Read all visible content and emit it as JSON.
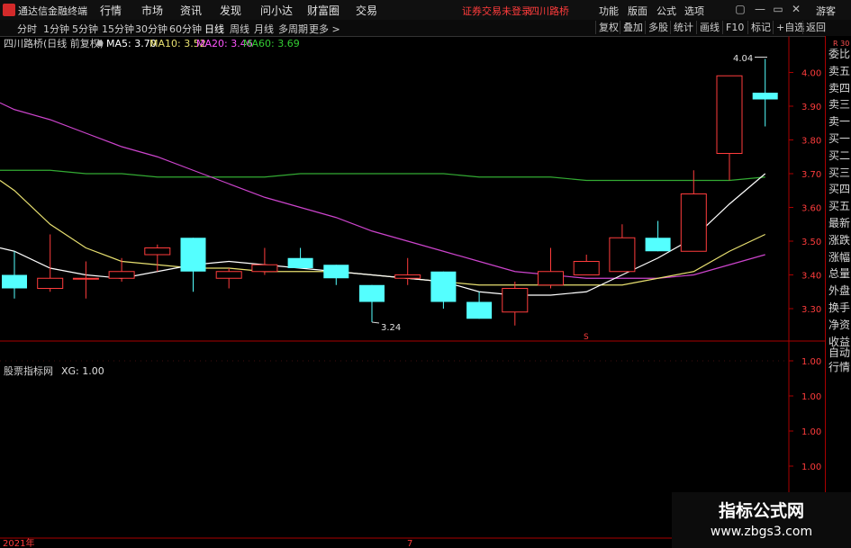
{
  "app": {
    "name": "通达信金融终端",
    "menu": [
      "行情",
      "市场",
      "资讯",
      "发现",
      "问小达",
      "财富圈",
      "交易"
    ],
    "status_text": "证券交易未登录",
    "stock_name": "四川路桥",
    "right_menu": [
      "功能",
      "版面",
      "公式",
      "选项"
    ],
    "guest": "游客",
    "window_controls": [
      "▢",
      "—",
      "▭",
      "✕"
    ]
  },
  "toolbar": {
    "periods": [
      "分时",
      "1分钟",
      "5分钟",
      "15分钟",
      "30分钟",
      "60分钟",
      "日线",
      "周线",
      "月线",
      "多周期",
      "更多 >"
    ],
    "active_period": "日线",
    "buttons": [
      "复权",
      "叠加",
      "多股",
      "统计",
      "画线",
      "F10",
      "标记",
      "+自选",
      "返回"
    ]
  },
  "main_panel": {
    "header": "四川路桥(日线 前复权)",
    "ma_labels": [
      {
        "text": "MA5: 3.70",
        "color": "#ffffff"
      },
      {
        "text": "MA10: 3.52",
        "color": "#e8e070"
      },
      {
        "text": "MA20: 3.46",
        "color": "#ff55ff"
      },
      {
        "text": "MA60: 3.69",
        "color": "#33cc33"
      }
    ],
    "price_ticks": [
      "4.00",
      "3.90",
      "3.80",
      "3.70",
      "3.60",
      "3.50",
      "3.40",
      "3.30"
    ],
    "high_annotation": "4.04",
    "low_annotation": "3.24",
    "marker_s": "S"
  },
  "sub_panel": {
    "header": "股票指标网",
    "xg_label": "XG: 1.00",
    "ticks": [
      "1.00",
      "1.00",
      "1.00",
      "1.00",
      "1.00"
    ]
  },
  "axis": {
    "year_label": "2021年",
    "month_label": "7"
  },
  "right_panel": {
    "top_badge": "R 30",
    "labels": [
      "委比",
      "卖五",
      "卖四",
      "卖三",
      "卖一",
      "买一",
      "买二",
      "买三",
      "买四",
      "买五",
      "最新",
      "涨跌",
      "涨幅",
      "总量",
      "外盘",
      "换手",
      "净资",
      "收益"
    ],
    "bottom_labels": [
      "自动",
      "行情"
    ]
  },
  "watermark": {
    "title": "指标公式网",
    "url": "www.zbgs3.com"
  },
  "colors": {
    "up": "#ff3c3c",
    "down": "#54ffff",
    "frame": "#aa0000",
    "ma5": "#ffffff",
    "ma10": "#e8e070",
    "ma20": "#cc44cc",
    "ma60": "#33aa33"
  },
  "chart_data": {
    "type": "candlestick",
    "y_range": [
      3.22,
      4.06
    ],
    "candles": [
      {
        "o": 3.4,
        "h": 3.47,
        "l": 3.33,
        "c": 3.36
      },
      {
        "o": 3.36,
        "h": 3.52,
        "l": 3.35,
        "c": 3.39
      },
      {
        "o": 3.39,
        "h": 3.44,
        "l": 3.33,
        "c": 3.39
      },
      {
        "o": 3.39,
        "h": 3.45,
        "l": 3.38,
        "c": 3.41
      },
      {
        "o": 3.46,
        "h": 3.49,
        "l": 3.41,
        "c": 3.48
      },
      {
        "o": 3.51,
        "h": 3.51,
        "l": 3.35,
        "c": 3.41
      },
      {
        "o": 3.39,
        "h": 3.42,
        "l": 3.36,
        "c": 3.41
      },
      {
        "o": 3.41,
        "h": 3.48,
        "l": 3.4,
        "c": 3.43
      },
      {
        "o": 3.45,
        "h": 3.48,
        "l": 3.42,
        "c": 3.42
      },
      {
        "o": 3.43,
        "h": 3.43,
        "l": 3.37,
        "c": 3.39
      },
      {
        "o": 3.37,
        "h": 3.37,
        "l": 3.26,
        "c": 3.32
      },
      {
        "o": 3.39,
        "h": 3.45,
        "l": 3.37,
        "c": 3.4
      },
      {
        "o": 3.41,
        "h": 3.41,
        "l": 3.3,
        "c": 3.32
      },
      {
        "o": 3.32,
        "h": 3.35,
        "l": 3.27,
        "c": 3.27
      },
      {
        "o": 3.29,
        "h": 3.38,
        "l": 3.25,
        "c": 3.36
      },
      {
        "o": 3.37,
        "h": 3.48,
        "l": 3.36,
        "c": 3.41
      },
      {
        "o": 3.4,
        "h": 3.46,
        "l": 3.4,
        "c": 3.44
      },
      {
        "o": 3.41,
        "h": 3.55,
        "l": 3.41,
        "c": 3.51
      },
      {
        "o": 3.51,
        "h": 3.56,
        "l": 3.47,
        "c": 3.47
      },
      {
        "o": 3.47,
        "h": 3.71,
        "l": 3.47,
        "c": 3.64
      },
      {
        "o": 3.76,
        "h": 3.99,
        "l": 3.68,
        "c": 3.99
      },
      {
        "o": 3.94,
        "h": 4.04,
        "l": 3.84,
        "c": 3.92
      }
    ],
    "ma5": [
      3.47,
      3.42,
      3.4,
      3.39,
      3.41,
      3.43,
      3.44,
      3.43,
      3.42,
      3.41,
      3.4,
      3.39,
      3.38,
      3.35,
      3.34,
      3.34,
      3.35,
      3.4,
      3.45,
      3.51,
      3.61,
      3.7
    ],
    "ma10": [
      3.65,
      3.55,
      3.48,
      3.44,
      3.43,
      3.42,
      3.42,
      3.41,
      3.41,
      3.41,
      3.4,
      3.39,
      3.38,
      3.37,
      3.37,
      3.37,
      3.37,
      3.37,
      3.39,
      3.41,
      3.47,
      3.52
    ],
    "ma20": [
      3.89,
      3.86,
      3.82,
      3.78,
      3.75,
      3.71,
      3.67,
      3.63,
      3.6,
      3.57,
      3.53,
      3.5,
      3.47,
      3.44,
      3.41,
      3.4,
      3.39,
      3.39,
      3.39,
      3.4,
      3.43,
      3.46
    ],
    "ma60": [
      3.71,
      3.71,
      3.7,
      3.7,
      3.69,
      3.69,
      3.69,
      3.69,
      3.7,
      3.7,
      3.7,
      3.7,
      3.7,
      3.69,
      3.69,
      3.69,
      3.68,
      3.68,
      3.68,
      3.68,
      3.68,
      3.69
    ],
    "indicator_xg": 1.0
  }
}
